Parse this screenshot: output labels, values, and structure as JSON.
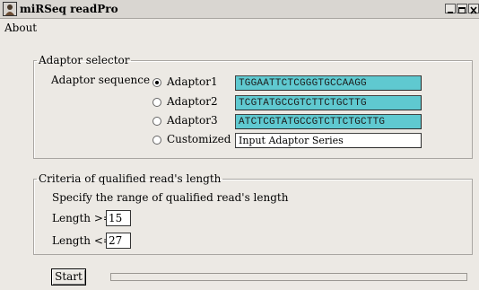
{
  "window": {
    "title": "miRSeq readPro"
  },
  "menu": {
    "about": "About"
  },
  "adaptor_selector": {
    "legend": "Adaptor selector",
    "sequence_label": "Adaptor sequence",
    "options": [
      {
        "label": "Adaptor1",
        "checked": true,
        "value": "TGGAATTCTCGGGTGCCAAGG"
      },
      {
        "label": "Adaptor2",
        "checked": false,
        "value": "TCGTATGCCGTCTTCTGCTTG"
      },
      {
        "label": "Adaptor3",
        "checked": false,
        "value": "ATCTCGTATGCCGTCTTCTGCTTG"
      },
      {
        "label": "Customized",
        "checked": false,
        "value": "Input Adaptor Series"
      }
    ]
  },
  "criteria": {
    "legend": "Criteria of qualified read's length",
    "instruction": "Specify the range of qualified read's length",
    "min_label": "Length >=",
    "min_value": "15",
    "max_label": "Length <=",
    "max_value": "27"
  },
  "actions": {
    "start_label": "Start"
  },
  "progress": {
    "value": 0
  },
  "colors": {
    "sequence_field": "#5fc9d0",
    "window_bg": "#ece9e4"
  }
}
